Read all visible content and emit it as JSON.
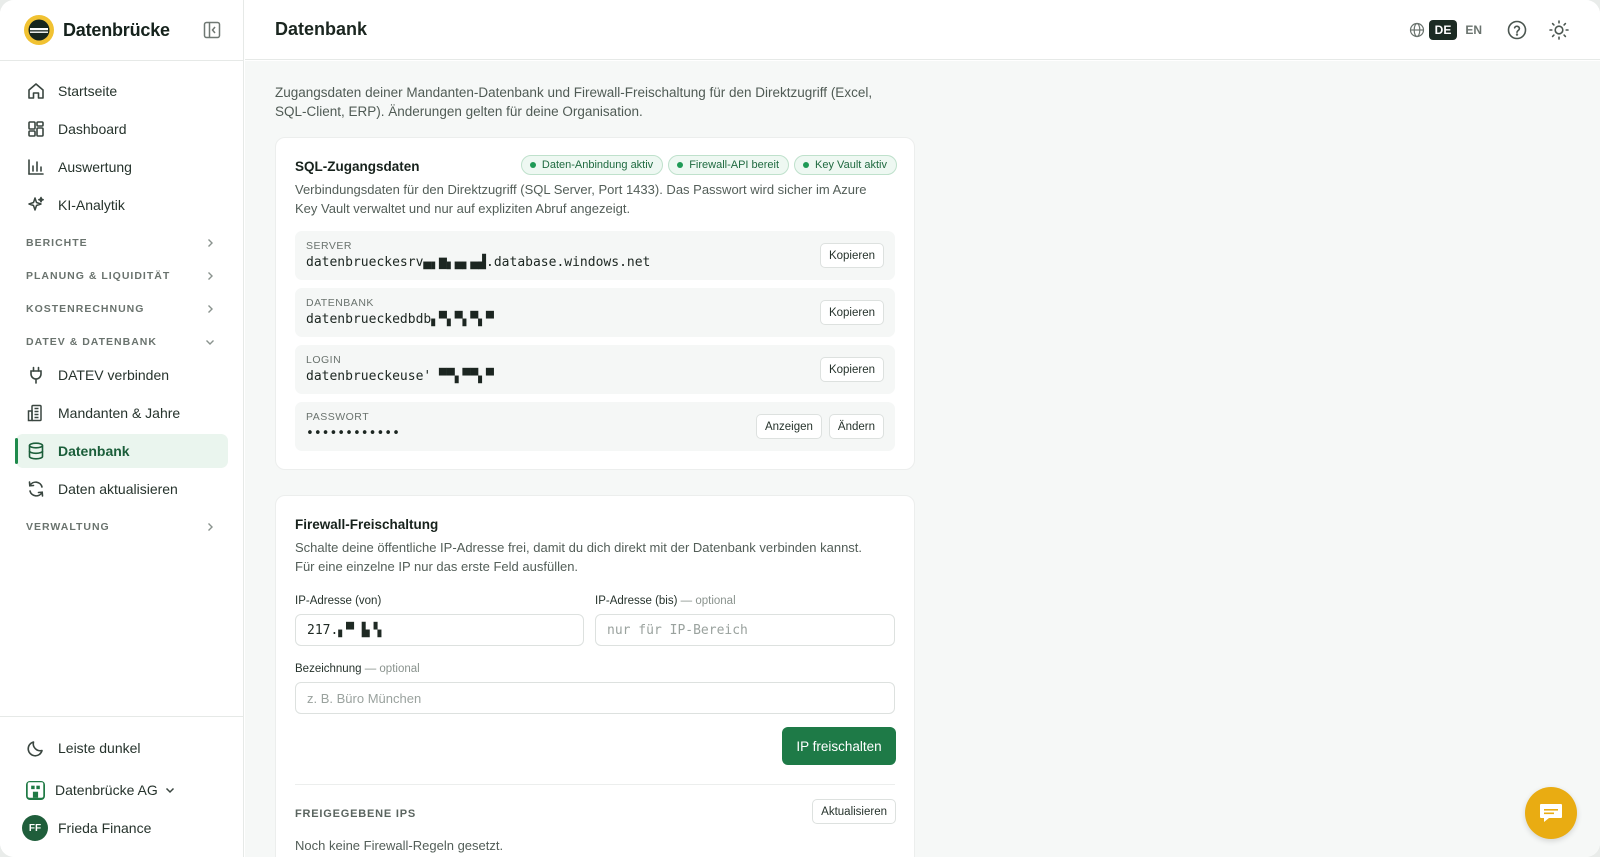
{
  "brand": {
    "name": "Datenbrücke"
  },
  "sidebar": {
    "main_items": [
      {
        "label": "Startseite",
        "icon": "home-icon"
      },
      {
        "label": "Dashboard",
        "icon": "dashboard-icon"
      },
      {
        "label": "Auswertung",
        "icon": "bar-chart-icon"
      },
      {
        "label": "KI-Analytik",
        "icon": "sparkles-icon"
      }
    ],
    "sections": {
      "berichte": "BERICHTE",
      "planung": "PLANUNG & LIQUIDITÄT",
      "kosten": "KOSTENRECHNUNG",
      "datev": "DATEV & DATENBANK",
      "verwaltung": "VERWALTUNG"
    },
    "datev_items": [
      {
        "label": "DATEV verbinden",
        "icon": "plug-icon"
      },
      {
        "label": "Mandanten & Jahre",
        "icon": "building-icon"
      },
      {
        "label": "Datenbank",
        "icon": "database-icon",
        "active": true
      },
      {
        "label": "Daten aktualisieren",
        "icon": "refresh-icon"
      }
    ],
    "bottom": {
      "theme_toggle": "Leiste dunkel",
      "org": "Datenbrücke AG",
      "user_initials": "FF",
      "user_name": "Frieda Finance"
    }
  },
  "header": {
    "title": "Datenbank",
    "lang_de": "DE",
    "lang_en": "EN"
  },
  "intro": "Zugangsdaten deiner Mandanten-Datenbank und Firewall-Freischaltung für den Direktzugriff (Excel, SQL-Client, ERP). Änderungen gelten für deine Organisation.",
  "sql_card": {
    "title": "SQL-Zugangsdaten",
    "badges": [
      "Daten-Anbindung aktiv",
      "Firewall-API bereit",
      "Key Vault aktiv"
    ],
    "description": "Verbindungsdaten für den Direktzugriff (SQL Server, Port 1433). Das Passwort wird sicher im Azure Key Vault verwaltet und nur auf expliziten Abruf angezeigt.",
    "fields": [
      {
        "label": "SERVER",
        "value": "datenbrueckesrv▄▖▆▖▄▖▄▟.database.windows.net",
        "button": "Kopieren"
      },
      {
        "label": "DATENBANK",
        "value": "datenbrueckedbdb▖▀▖▀▖▀▖▀",
        "button": "Kopieren"
      },
      {
        "label": "LOGIN",
        "value": "datenbrueckeuse'  ▀▀▖▀▀▖▀",
        "button": "Kopieren"
      },
      {
        "label": "PASSWORT",
        "value": "••••••••••••",
        "button_show": "Anzeigen",
        "button_change": "Ändern"
      }
    ]
  },
  "firewall_card": {
    "title": "Firewall-Freischaltung",
    "description": "Schalte deine öffentliche IP-Adresse frei, damit du dich direkt mit der Datenbank verbinden kannst. Für eine einzelne IP nur das erste Feld ausfüllen.",
    "ip_from_label": "IP-Adresse (von)",
    "ip_from_value": "217.▖▀    ▙▝▖",
    "ip_to_label": "IP-Adresse (bis)",
    "ip_to_optional": "— optional",
    "ip_to_placeholder": "nur für IP-Bereich",
    "desc_label": "Bezeichnung",
    "desc_optional": "— optional",
    "desc_placeholder": "z. B. Büro München",
    "submit": "IP freischalten",
    "list_title": "FREIGEGEBENE IPS",
    "refresh": "Aktualisieren",
    "empty": "Noch keine Firewall-Regeln gesetzt."
  },
  "colors": {
    "accent": "#1e7a47",
    "active_bg": "#eaf5ee",
    "chat_button": "#e9ac12",
    "brand_logo": "#f1c232"
  }
}
